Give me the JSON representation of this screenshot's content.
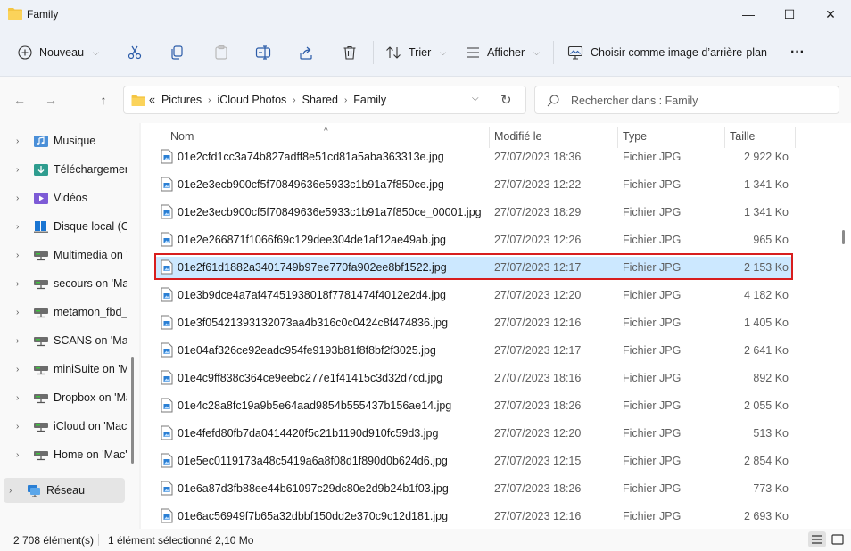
{
  "window": {
    "title": "Family",
    "minimize": "—",
    "maximize": "☐",
    "close": "✕"
  },
  "toolbar": {
    "new_label": "Nouveau",
    "sort_label": "Trier",
    "view_label": "Afficher",
    "wallpaper_label": "Choisir comme image d’arrière-plan",
    "more_label": "···"
  },
  "address": {
    "overflow": "«",
    "crumbs": [
      "Pictures",
      "iCloud Photos",
      "Shared",
      "Family"
    ]
  },
  "search": {
    "placeholder": "Rechercher dans : Family"
  },
  "sidebar": {
    "items": [
      {
        "label": "Musique",
        "icon": "music-folder-icon"
      },
      {
        "label": "Téléchargements",
        "icon": "downloads-folder-icon"
      },
      {
        "label": "Vidéos",
        "icon": "videos-folder-icon"
      },
      {
        "label": "Disque local (C:)",
        "icon": "windows-drive-icon"
      },
      {
        "label": "Multimedia on 'Mac'",
        "icon": "network-drive-icon"
      },
      {
        "label": "secours on 'Mac'",
        "icon": "network-drive-icon"
      },
      {
        "label": "metamon_fbd_",
        "icon": "network-drive-icon"
      },
      {
        "label": "SCANS on 'Mac'",
        "icon": "network-drive-icon"
      },
      {
        "label": "miniSuite on 'Mac'",
        "icon": "network-drive-icon"
      },
      {
        "label": "Dropbox on 'Mac'",
        "icon": "network-drive-icon"
      },
      {
        "label": "iCloud on 'Mac'",
        "icon": "network-drive-icon"
      },
      {
        "label": "Home on 'Mac'",
        "icon": "network-drive-icon"
      },
      {
        "label": "Réseau",
        "icon": "network-icon"
      }
    ]
  },
  "columns": {
    "name": "Nom",
    "modified": "Modifié le",
    "type": "Type",
    "size": "Taille"
  },
  "files": [
    {
      "name": "01e2cfd1cc3a74b827adff8e51cd81a5aba363313e.jpg",
      "modified": "27/07/2023 18:36",
      "type": "Fichier JPG",
      "size": "2 922 Ko"
    },
    {
      "name": "01e2e3ecb900cf5f70849636e5933c1b91a7f850ce.jpg",
      "modified": "27/07/2023 12:22",
      "type": "Fichier JPG",
      "size": "1 341 Ko"
    },
    {
      "name": "01e2e3ecb900cf5f70849636e5933c1b91a7f850ce_00001.jpg",
      "modified": "27/07/2023 18:29",
      "type": "Fichier JPG",
      "size": "1 341 Ko"
    },
    {
      "name": "01e2e266871f1066f69c129dee304de1af12ae49ab.jpg",
      "modified": "27/07/2023 12:26",
      "type": "Fichier JPG",
      "size": "965 Ko"
    },
    {
      "name": "01e2f61d1882a3401749b97ee770fa902ee8bf1522.jpg",
      "modified": "27/07/2023 12:17",
      "type": "Fichier JPG",
      "size": "2 153 Ko"
    },
    {
      "name": "01e3b9dce4a7af47451938018f7781474f4012e2d4.jpg",
      "modified": "27/07/2023 12:20",
      "type": "Fichier JPG",
      "size": "4 182 Ko"
    },
    {
      "name": "01e3f05421393132073aa4b316c0c0424c8f474836.jpg",
      "modified": "27/07/2023 12:16",
      "type": "Fichier JPG",
      "size": "1 405 Ko"
    },
    {
      "name": "01e04af326ce92eadc954fe9193b81f8f8bf2f3025.jpg",
      "modified": "27/07/2023 12:17",
      "type": "Fichier JPG",
      "size": "2 641 Ko"
    },
    {
      "name": "01e4c9ff838c364ce9eebc277e1f41415c3d32d7cd.jpg",
      "modified": "27/07/2023 18:16",
      "type": "Fichier JPG",
      "size": "892 Ko"
    },
    {
      "name": "01e4c28a8fc19a9b5e64aad9854b555437b156ae14.jpg",
      "modified": "27/07/2023 18:26",
      "type": "Fichier JPG",
      "size": "2 055 Ko"
    },
    {
      "name": "01e4fefd80fb7da0414420f5c21b1190d910fc59d3.jpg",
      "modified": "27/07/2023 12:20",
      "type": "Fichier JPG",
      "size": "513 Ko"
    },
    {
      "name": "01e5ec0119173a48c5419a6a8f08d1f890d0b624d6.jpg",
      "modified": "27/07/2023 12:15",
      "type": "Fichier JPG",
      "size": "2 854 Ko"
    },
    {
      "name": "01e6a87d3fb88ee44b61097c29dc80e2d9b24b1f03.jpg",
      "modified": "27/07/2023 18:26",
      "type": "Fichier JPG",
      "size": "773 Ko"
    },
    {
      "name": "01e6ac56949f7b65a32dbbf150dd2e370c9c12d181.jpg",
      "modified": "27/07/2023 12:16",
      "type": "Fichier JPG",
      "size": "2 693 Ko"
    }
  ],
  "selected_index": 4,
  "status": {
    "count": "2 708 élément(s)",
    "selection": "1 élément sélectionné  2,10 Mo"
  },
  "colors": {
    "selection": "#cce8ff",
    "highlight_border": "#d81e1e",
    "folder": "#f4c542"
  }
}
